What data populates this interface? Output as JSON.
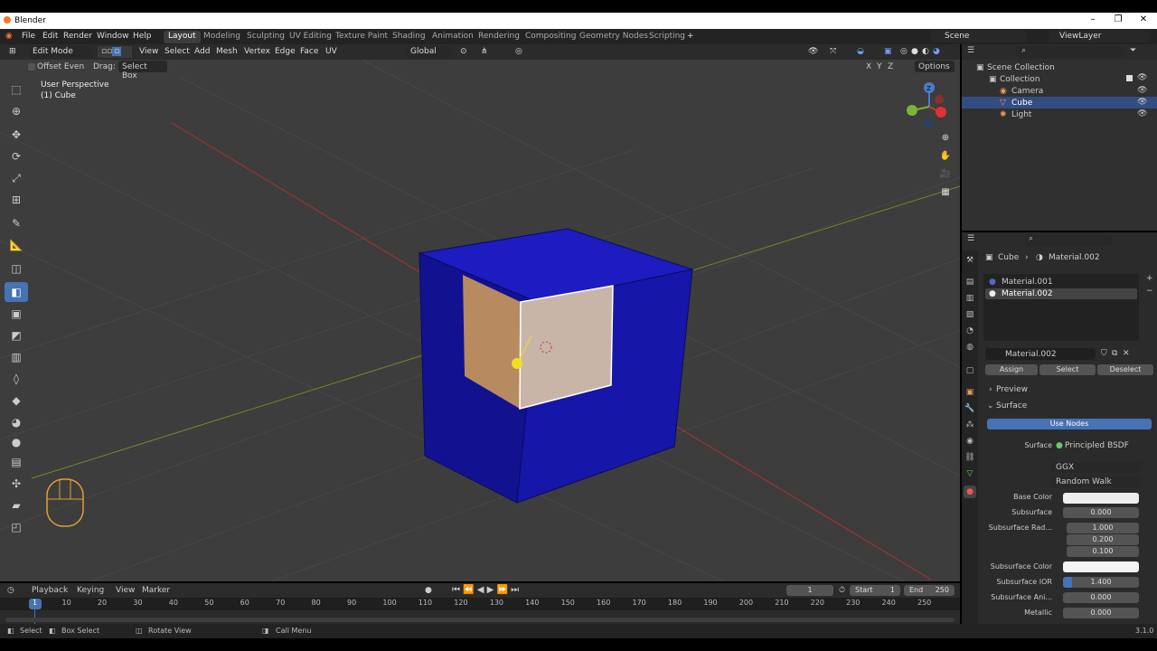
{
  "app": {
    "title": "Blender"
  },
  "window_controls": {
    "minimize": "–",
    "maximize": "❐",
    "close": "✕"
  },
  "menu": [
    "File",
    "Edit",
    "Render",
    "Window",
    "Help"
  ],
  "workspaces": [
    "Layout",
    "Modeling",
    "Sculpting",
    "UV Editing",
    "Texture Paint",
    "Shading",
    "Animation",
    "Rendering",
    "Compositing",
    "Geometry Nodes",
    "Scripting"
  ],
  "workspace_add": "+",
  "scene": {
    "label": "Scene",
    "viewlayer": "ViewLayer"
  },
  "header": {
    "mode": "Edit Mode",
    "menus": [
      "View",
      "Select",
      "Add",
      "Mesh",
      "Vertex",
      "Edge",
      "Face",
      "UV"
    ],
    "orientation": "Global"
  },
  "subheader": {
    "offset_even": "Offset Even",
    "drag_label": "Drag:",
    "drag_value": "Select Box",
    "axes": [
      "X",
      "Y",
      "Z"
    ],
    "options": "Options"
  },
  "viewport": {
    "perspective": "User Perspective",
    "object": "(1) Cube"
  },
  "gizmo": {
    "z": "Z",
    "y": "Y",
    "x": "X"
  },
  "outliner": {
    "root": "Scene Collection",
    "collection": "Collection",
    "items": [
      "Camera",
      "Cube",
      "Light"
    ]
  },
  "properties": {
    "breadcrumb_object": "Cube",
    "breadcrumb_material": "Material.002",
    "slots": [
      "Material.001",
      "Material.002"
    ],
    "material_name": "Material.002",
    "buttons": [
      "Assign",
      "Select",
      "Deselect"
    ],
    "panels": {
      "preview": "Preview",
      "surface": "Surface"
    },
    "use_nodes": "Use Nodes",
    "surface_label": "Surface",
    "surface_value": "Principled BSDF",
    "distribution": "GGX",
    "subsurface_method": "Random Walk",
    "fields": [
      {
        "label": "Base Color",
        "value": ""
      },
      {
        "label": "Subsurface",
        "value": "0.000"
      },
      {
        "label": "Subsurface Rad...",
        "value": "1.000"
      },
      {
        "label": "",
        "value": "0.200"
      },
      {
        "label": "",
        "value": "0.100"
      },
      {
        "label": "Subsurface Color",
        "value": ""
      },
      {
        "label": "Subsurface IOR",
        "value": "1.400"
      },
      {
        "label": "Subsurface Ani...",
        "value": "0.000"
      },
      {
        "label": "Metallic",
        "value": "0.000"
      }
    ]
  },
  "timeline": {
    "menus": [
      "Playback",
      "Keying",
      "View",
      "Marker"
    ],
    "current_frame": "1",
    "start_label": "Start",
    "start": "1",
    "end_label": "End",
    "end": "250",
    "ticks": [
      "1",
      "10",
      "20",
      "30",
      "40",
      "50",
      "60",
      "70",
      "80",
      "90",
      "100",
      "110",
      "120",
      "130",
      "140",
      "150",
      "160",
      "170",
      "180",
      "190",
      "200",
      "210",
      "220",
      "230",
      "240",
      "250"
    ]
  },
  "status": {
    "select": "Select",
    "box_select": "Box Select",
    "rotate": "Rotate View",
    "call_menu": "Call Menu",
    "version": "3.1.0"
  },
  "colors": {
    "cube": "#1414b4",
    "face_selected": "#c9b5a8",
    "accent": "#4772b3"
  }
}
